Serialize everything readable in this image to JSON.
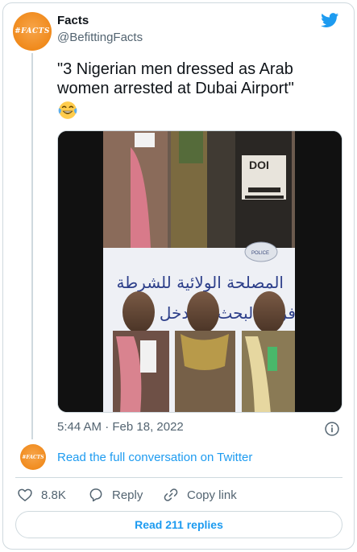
{
  "author": {
    "name": "Facts",
    "handle": "@BefittingFacts",
    "avatar_text": "#FACTS"
  },
  "tweet": {
    "text": "\"3 Nigerian men dressed as Arab women arrested at Dubai Airport\"",
    "emoji": "face-with-tears-of-joy",
    "timestamp": "5:44 AM · Feb 18, 2022"
  },
  "media": {
    "photo_text": {
      "jacket_text": "DOI",
      "police_badge": "POLICE",
      "banner_arabic_line1": "المصلحة الولائية للشرطة",
      "banner_arabic_line2": "فرقة البحث والتدخل"
    }
  },
  "conversation_link": "Read the full conversation on Twitter",
  "actions": {
    "likes": "8.8K",
    "reply": "Reply",
    "copy_link": "Copy link"
  },
  "read_replies": "Read 211 replies",
  "colors": {
    "twitter_blue": "#1d9bf0",
    "text_primary": "#0f1419",
    "text_secondary": "#536471",
    "border": "#cfd9de",
    "avatar_orange": "#f08a1c"
  }
}
